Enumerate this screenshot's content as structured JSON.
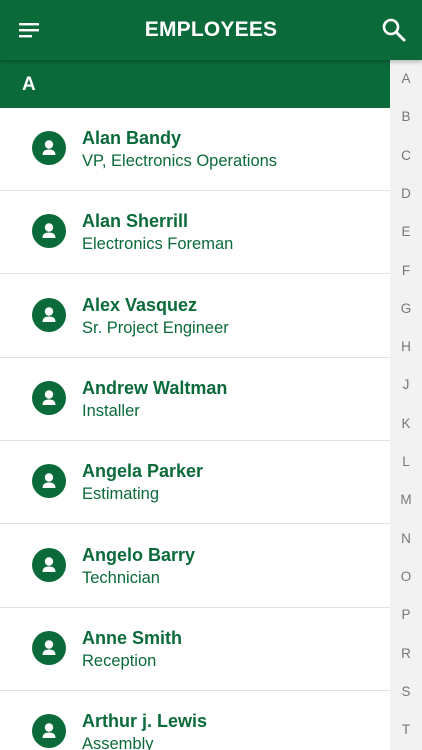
{
  "appbar": {
    "title": "EMPLOYEES",
    "menu_icon": "hamburger-menu-icon",
    "search_icon": "search-icon",
    "color": "#0b6a3a"
  },
  "section": {
    "header": "A"
  },
  "employees": [
    {
      "name": "Alan Bandy",
      "title": "VP, Electronics Operations"
    },
    {
      "name": "Alan Sherrill",
      "title": "Electronics Foreman"
    },
    {
      "name": "Alex Vasquez",
      "title": "Sr. Project Engineer"
    },
    {
      "name": "Andrew Waltman",
      "title": "Installer"
    },
    {
      "name": "Angela Parker",
      "title": "Estimating"
    },
    {
      "name": "Angelo Barry",
      "title": "Technician"
    },
    {
      "name": "Anne Smith",
      "title": "Reception"
    },
    {
      "name": "Arthur j.  Lewis",
      "title": "Assembly"
    }
  ],
  "index_letters": [
    "A",
    "B",
    "C",
    "D",
    "E",
    "F",
    "G",
    "H",
    "J",
    "K",
    "L",
    "M",
    "N",
    "O",
    "P",
    "R",
    "S",
    "T"
  ]
}
